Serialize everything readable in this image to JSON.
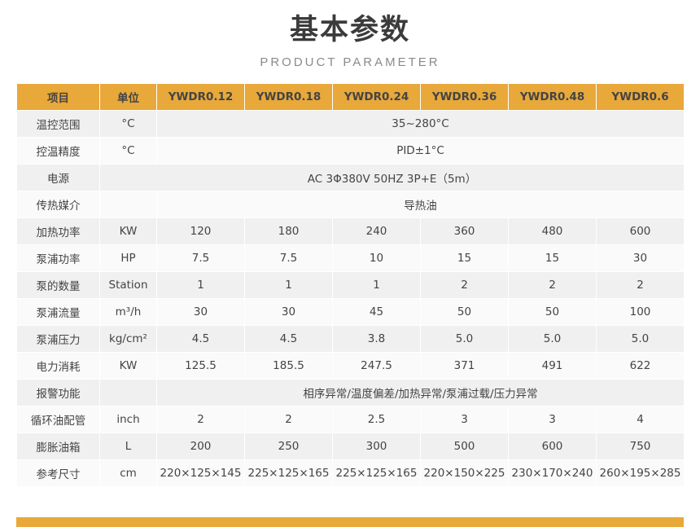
{
  "header": {
    "title": "基本参数",
    "subtitle": "PRODUCT PARAMETER"
  },
  "colors": {
    "accent": "#e8a83a",
    "row_odd": "#f0f0f0",
    "row_even": "#fafafa",
    "header_text": "#ffffff"
  },
  "table": {
    "columns": [
      "项目",
      "单位",
      "YWDR0.12",
      "YWDR0.18",
      "YWDR0.24",
      "YWDR0.36",
      "YWDR0.48",
      "YWDR0.6"
    ],
    "rows": [
      {
        "label": "温控范围",
        "unit": "°C",
        "merged": "35~280°C"
      },
      {
        "label": "控温精度",
        "unit": "°C",
        "merged": "PID±1°C"
      },
      {
        "label": "电源",
        "unit": "",
        "merged": "AC 3Φ380V 50HZ 3P+E（5m）",
        "merge_unit": true
      },
      {
        "label": "传热媒介",
        "unit": "",
        "merged": "导热油"
      },
      {
        "label": "加热功率",
        "unit": "KW",
        "values": [
          "120",
          "180",
          "240",
          "360",
          "480",
          "600"
        ]
      },
      {
        "label": "泵浦功率",
        "unit": "HP",
        "values": [
          "7.5",
          "7.5",
          "10",
          "15",
          "15",
          "30"
        ]
      },
      {
        "label": "泵的数量",
        "unit": "Station",
        "values": [
          "1",
          "1",
          "1",
          "2",
          "2",
          "2"
        ]
      },
      {
        "label": "泵浦流量",
        "unit": "m³/h",
        "values": [
          "30",
          "30",
          "45",
          "50",
          "50",
          "100"
        ]
      },
      {
        "label": "泵浦压力",
        "unit": "kg/cm²",
        "values": [
          "4.5",
          "4.5",
          "3.8",
          "5.0",
          "5.0",
          "5.0"
        ]
      },
      {
        "label": "电力消耗",
        "unit": "KW",
        "values": [
          "125.5",
          "185.5",
          "247.5",
          "371",
          "491",
          "622"
        ]
      },
      {
        "label": "报警功能",
        "unit": "",
        "merged": "相序异常/温度偏差/加热异常/泵浦过载/压力异常"
      },
      {
        "label": "循环油配管",
        "unit": "inch",
        "values": [
          "2",
          "2",
          "2.5",
          "3",
          "3",
          "4"
        ]
      },
      {
        "label": "膨胀油箱",
        "unit": "L",
        "values": [
          "200",
          "250",
          "300",
          "500",
          "600",
          "750"
        ]
      },
      {
        "label": "参考尺寸",
        "unit": "cm",
        "values": [
          "220×125×145",
          "225×125×165",
          "225×125×165",
          "220×150×225",
          "230×170×240",
          "260×195×285"
        ],
        "small": true
      }
    ]
  }
}
